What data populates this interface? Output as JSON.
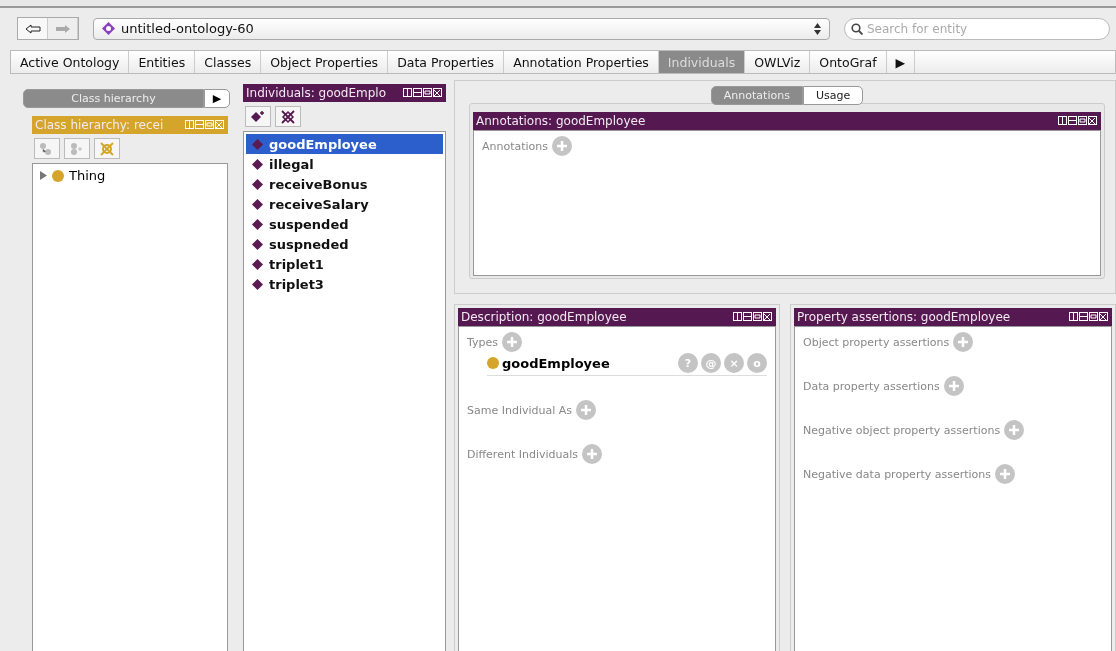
{
  "toolbar": {
    "ontology": "untitled-ontology-60",
    "search": {
      "placeholder": "Search for entity"
    }
  },
  "tabs": [
    {
      "label": "Active Ontology",
      "selected": false
    },
    {
      "label": "Entities",
      "selected": false
    },
    {
      "label": "Classes",
      "selected": false
    },
    {
      "label": "Object Properties",
      "selected": false
    },
    {
      "label": "Data Properties",
      "selected": false
    },
    {
      "label": "Annotation Properties",
      "selected": false
    },
    {
      "label": "Individuals",
      "selected": true
    },
    {
      "label": "OWLViz",
      "selected": false
    },
    {
      "label": "OntoGraf",
      "selected": false
    }
  ],
  "tabs_more": "▶",
  "class_view": {
    "tab": {
      "label": "Class hierarchy",
      "selected": true
    },
    "more": "▶",
    "header": "Class hierarchy: recei",
    "tree": [
      {
        "label": "Thing",
        "expanded": false
      }
    ]
  },
  "individuals": {
    "header": "Individuals: goodEmplo",
    "items": [
      {
        "label": "goodEmployee",
        "selected": true
      },
      {
        "label": "illegal",
        "selected": false
      },
      {
        "label": "receiveBonus",
        "selected": false
      },
      {
        "label": "receiveSalary",
        "selected": false
      },
      {
        "label": "suspended",
        "selected": false
      },
      {
        "label": "suspneded",
        "selected": false
      },
      {
        "label": "triplet1",
        "selected": false
      },
      {
        "label": "triplet3",
        "selected": false
      }
    ]
  },
  "detail_tabs": [
    {
      "label": "Annotations",
      "selected": true
    },
    {
      "label": "Usage",
      "selected": false
    }
  ],
  "annotations": {
    "header": "Annotations: goodEmployee",
    "sections": [
      "Annotations"
    ]
  },
  "description": {
    "header": "Description: goodEmployee",
    "types_label": "Types",
    "types": [
      {
        "label": "goodEmployee",
        "actions": [
          "?",
          "@",
          "×",
          "o"
        ]
      }
    ],
    "sections": [
      "Same Individual As",
      "Different Individuals"
    ]
  },
  "property_assertions": {
    "header": "Property assertions: goodEmployee",
    "sections": [
      "Object property assertions",
      "Data property assertions",
      "Negative object property assertions",
      "Negative data property assertions"
    ]
  }
}
